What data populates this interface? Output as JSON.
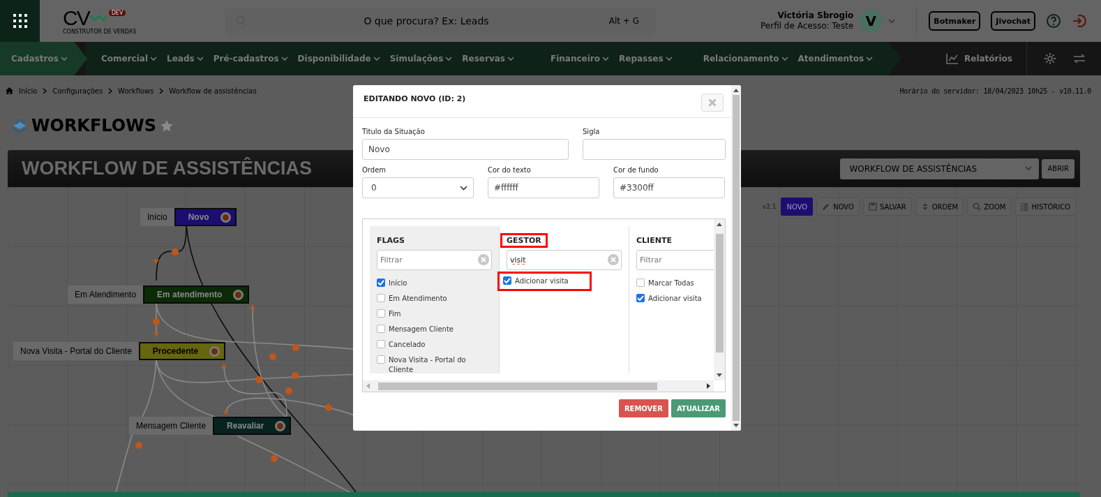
{
  "header": {
    "logo": {
      "text": "CV",
      "badge": "DEV",
      "tagline": "CONSTRUTOR DE VENDAS"
    },
    "search": {
      "placeholder": "O que procura? Ex: Leads",
      "shortcut": "Alt + G"
    },
    "user": {
      "name": "Victória Sbrogio",
      "profile": "Perfil de Acesso: Teste",
      "avatar": "V"
    },
    "buttons": [
      "Botmaker",
      "Jivochat"
    ]
  },
  "nav": {
    "groups": [
      {
        "items": [
          "Cadastros"
        ]
      },
      {
        "items": [
          "Comercial",
          "Leads",
          "Pré-cadastros",
          "Disponibilidade",
          "Simulações",
          "Reservas"
        ]
      },
      {
        "items": [
          "Financeiro",
          "Repasses"
        ]
      },
      {
        "items": [
          "Relacionamento",
          "Atendimentos"
        ]
      }
    ],
    "reports": "Relatórios"
  },
  "breadcrumb": [
    "Início",
    "Configurações",
    "Workflows",
    "Workflow de assistências"
  ],
  "server_time": "Horário do servidor: 18/04/2023 10h25 - v10.11.0",
  "page_title": "WORKFLOWS",
  "workflow": {
    "title": "WORKFLOW DE ASSISTÊNCIAS",
    "selector": "WORKFLOW DE ASSISTÊNCIAS",
    "open_button": "ABRIR",
    "version": "v2.1",
    "toolbar": [
      {
        "label": "NOVO",
        "kind": "status",
        "color": "#1c0e70"
      },
      {
        "label": "NOVO",
        "kind": "edit"
      },
      {
        "label": "SALVAR",
        "kind": "save"
      },
      {
        "label": "ORDEM",
        "kind": "order"
      },
      {
        "label": "ZOOM",
        "kind": "zoom"
      },
      {
        "label": "HISTÓRICO",
        "kind": "history"
      }
    ],
    "nodes": [
      {
        "label": "Início",
        "name": "Novo",
        "color": "#1c0e70"
      },
      {
        "label": "Em Atendimento",
        "name": "Em atendimento",
        "color": "#0b2a06"
      },
      {
        "label": "Nova Visita - Portal do Cliente",
        "name": "Procedente",
        "color": "#66660e"
      },
      {
        "label": "Mensagem Cliente",
        "name": "Reavaliar",
        "color": "#062320"
      }
    ]
  },
  "modal": {
    "title": "EDITANDO NOVO (ID: 2)",
    "fields": [
      {
        "label": "Titulo da Situação",
        "value": "Novo",
        "kind": "text"
      },
      {
        "label": "Sigla",
        "kind": "text"
      },
      {
        "label": "Ordem",
        "value": "0",
        "kind": "select"
      },
      {
        "label": "Cor do texto",
        "value": "#ffffff",
        "kind": "text"
      },
      {
        "label": "Cor de fundo",
        "value": "#3300ff",
        "kind": "text"
      }
    ],
    "columns": [
      {
        "title": "FLAGS",
        "highlighted": false,
        "filter": {
          "placeholder": "Filtrar"
        },
        "items": [
          {
            "label": "Início",
            "checked": true,
            "highlighted": false
          },
          {
            "label": "Em Atendimento",
            "checked": false,
            "highlighted": false
          },
          {
            "label": "Fim",
            "checked": false,
            "highlighted": false
          },
          {
            "label": "Mensagem Cliente",
            "checked": false,
            "highlighted": false
          },
          {
            "label": "Cancelado",
            "checked": false,
            "highlighted": false
          },
          {
            "label": "Nova Visita - Portal do Cliente",
            "checked": false,
            "highlighted": false
          }
        ]
      },
      {
        "title": "GESTOR",
        "highlighted": true,
        "filter": {
          "value": "visit"
        },
        "items": [
          {
            "label": "Adicionar visita",
            "checked": true,
            "highlighted": true
          }
        ]
      },
      {
        "title": "CLIENTE",
        "highlighted": false,
        "filter": {
          "placeholder": "Filtrar"
        },
        "items": [
          {
            "label": "Marcar Todas",
            "checked": false,
            "highlighted": false
          },
          {
            "label": "Adicionar visita",
            "checked": true,
            "highlighted": false
          }
        ]
      }
    ],
    "buttons": [
      {
        "label": "REMOVER",
        "kind": "danger"
      },
      {
        "label": "ATUALIZAR",
        "kind": "primary"
      }
    ]
  }
}
